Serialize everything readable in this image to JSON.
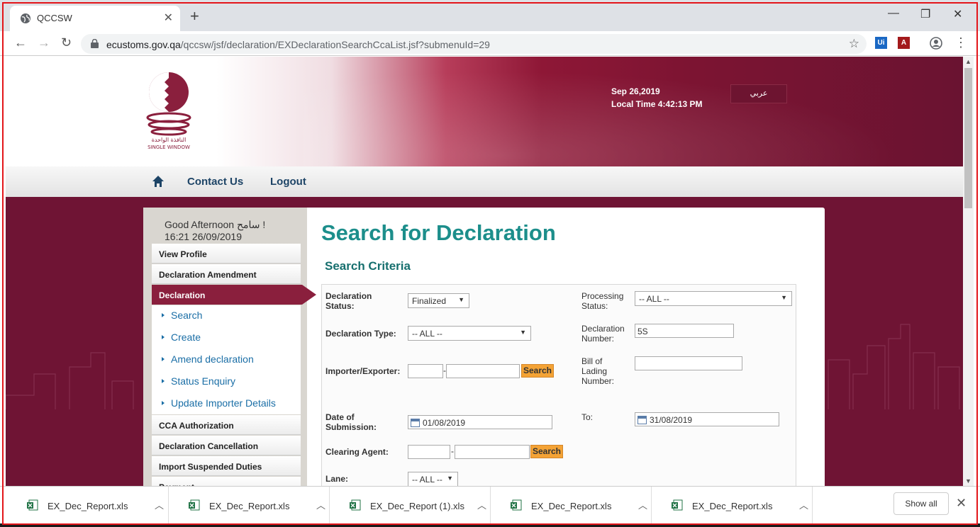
{
  "browser": {
    "tab_title": "QCCSW",
    "tab_close": "✕",
    "new_tab": "+",
    "url_host": "ecustoms.gov.qa",
    "url_path": "/qccsw/jsf/declaration/EXDeclarationSearchCcaList.jsf?submenuId=29",
    "back": "←",
    "forward": "→",
    "reload": "↻",
    "star": "☆",
    "window_min": "—",
    "window_max": "❐",
    "window_close": "✕",
    "menu": "⋮"
  },
  "header": {
    "date": "Sep 26,2019",
    "local_time": "Local Time 4:42:13 PM",
    "arabic_button": "عربي",
    "logo_text_ar": "النافذة الواحدة",
    "logo_text_en": "SINGLE WINDOW"
  },
  "menubar": {
    "contact": "Contact Us",
    "logout": "Logout"
  },
  "sidebar": {
    "greeting": "Good Afternoon   سامح !",
    "datetime": "16:21 26/09/2019",
    "items": [
      {
        "label": "View Profile"
      },
      {
        "label": "Declaration Amendment"
      },
      {
        "label": "Declaration"
      }
    ],
    "sub_items": [
      {
        "label": "Search"
      },
      {
        "label": "Create"
      },
      {
        "label": "Amend declaration"
      },
      {
        "label": "Status Enquiry"
      },
      {
        "label": "Update Importer Details"
      }
    ],
    "items_after": [
      {
        "label": "CCA Authorization"
      },
      {
        "label": "Declaration Cancellation"
      },
      {
        "label": "Import Suspended Duties"
      },
      {
        "label": "Payment"
      }
    ]
  },
  "main": {
    "title": "Search for Declaration",
    "section": "Search Criteria",
    "form": {
      "declaration_status_label": "Declaration Status:",
      "declaration_status_value": "Finalized",
      "processing_status_label": "Processing Status:",
      "processing_status_value": "-- ALL --",
      "declaration_type_label": "Declaration Type:",
      "declaration_type_value": "-- ALL --",
      "declaration_number_label": "Declaration Number:",
      "declaration_number_value": "5S",
      "importer_label": "Importer/Exporter:",
      "importer_code": "",
      "importer_name": "",
      "search_label": "Search",
      "bol_label": "Bill of Lading Number:",
      "bol_value": "",
      "date_from_label": "Date of Submission:",
      "date_from_value": "01/08/2019",
      "date_to_label": "To:",
      "date_to_value": "31/08/2019",
      "clearing_agent_label": "Clearing Agent:",
      "lane_label": "Lane:",
      "lane_value": "-- ALL --",
      "dash": "-"
    }
  },
  "downloads": {
    "items": [
      {
        "name": "EX_Dec_Report.xls"
      },
      {
        "name": "EX_Dec_Report.xls"
      },
      {
        "name": "EX_Dec_Report (1).xls"
      },
      {
        "name": "EX_Dec_Report.xls"
      },
      {
        "name": "EX_Dec_Report.xls"
      }
    ],
    "show_all": "Show all",
    "close": "✕"
  },
  "colors": {
    "maroon": "#6f1434",
    "teal_title": "#1c8e8b",
    "nav_blue": "#1d4466",
    "search_orange": "#f4a335",
    "link_blue": "#1a6ea6"
  }
}
